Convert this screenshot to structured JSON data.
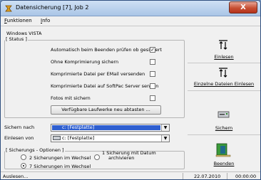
{
  "window": {
    "title": "Datensicherung [7], Job 2",
    "close_glyph": "X"
  },
  "menu": {
    "items": [
      "Funktionen",
      "Info"
    ]
  },
  "main": {
    "os_label": "Windows VISTA",
    "status_group_title": "[ Status ]",
    "options": [
      {
        "label": "Automatisch beim Beenden prüfen ob gesichert",
        "checked": true,
        "mark": "✓"
      },
      {
        "label": "Ohne Komprimierung sichern",
        "checked": false,
        "mark": ""
      },
      {
        "label": "Komprimierte Datei per EMail versenden",
        "checked": false,
        "mark": ""
      },
      {
        "label": "Komprimierte Datei auf SoftPac Server senden",
        "checked": false,
        "mark": ""
      },
      {
        "label": "Fotos mit sichern",
        "checked": false,
        "mark": ""
      }
    ],
    "scan_button": "Verfügbare Laufwerke neu abtasten ...",
    "save_to_label": "Sichern nach",
    "save_to_value": "c: [Festplatte]",
    "read_from_label": "Einlesen von",
    "read_from_value": "c: [Festplatte]",
    "backup_options_title": "[ Sicherungs - Optionen ]",
    "radio_2": "2 Sicherungen im Wechsel",
    "radio_1_line1": "1 Sicherung mit Datum",
    "radio_1_line2": "archivieren",
    "radio_7": "7 Sicherungen im Wechsel",
    "combo_arrow": "▼"
  },
  "side": {
    "einlesen": "Einlesen",
    "einzelne": "Einzelne Dateien Einlesen",
    "sichern": "Sichern",
    "beenden": "Beenden"
  },
  "status": {
    "left": "Auslesen...",
    "date": "22.07.2010",
    "time": "00:00:00"
  },
  "colors": {
    "selection": "#2f5fd0",
    "title_gradient_top": "#cfe0f4",
    "close": "#c74f33"
  },
  "icons": [
    "datensicherung-app-icon",
    "import-arrows-icon",
    "single-import-arrows-icon",
    "save-drive-icon",
    "exit-door-icon"
  ]
}
